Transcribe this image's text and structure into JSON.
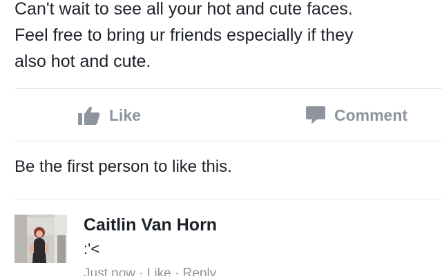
{
  "post": {
    "lines": [
      "Can't wait to see all your hot and cute faces.",
      "Feel free to bring ur friends especially if they",
      "also hot and cute."
    ]
  },
  "actions": {
    "like_label": "Like",
    "like_icon": "thumbs-up-icon",
    "comment_label": "Comment",
    "comment_icon": "speech-bubble-icon",
    "icon_color": "#8d949e"
  },
  "likes_summary": "Be the first person to like this.",
  "comment": {
    "author": "Caitlin Van Horn",
    "text": ":'<",
    "time": "Just now",
    "separator": " · ",
    "like_label": "Like",
    "reply_label": "Reply"
  }
}
